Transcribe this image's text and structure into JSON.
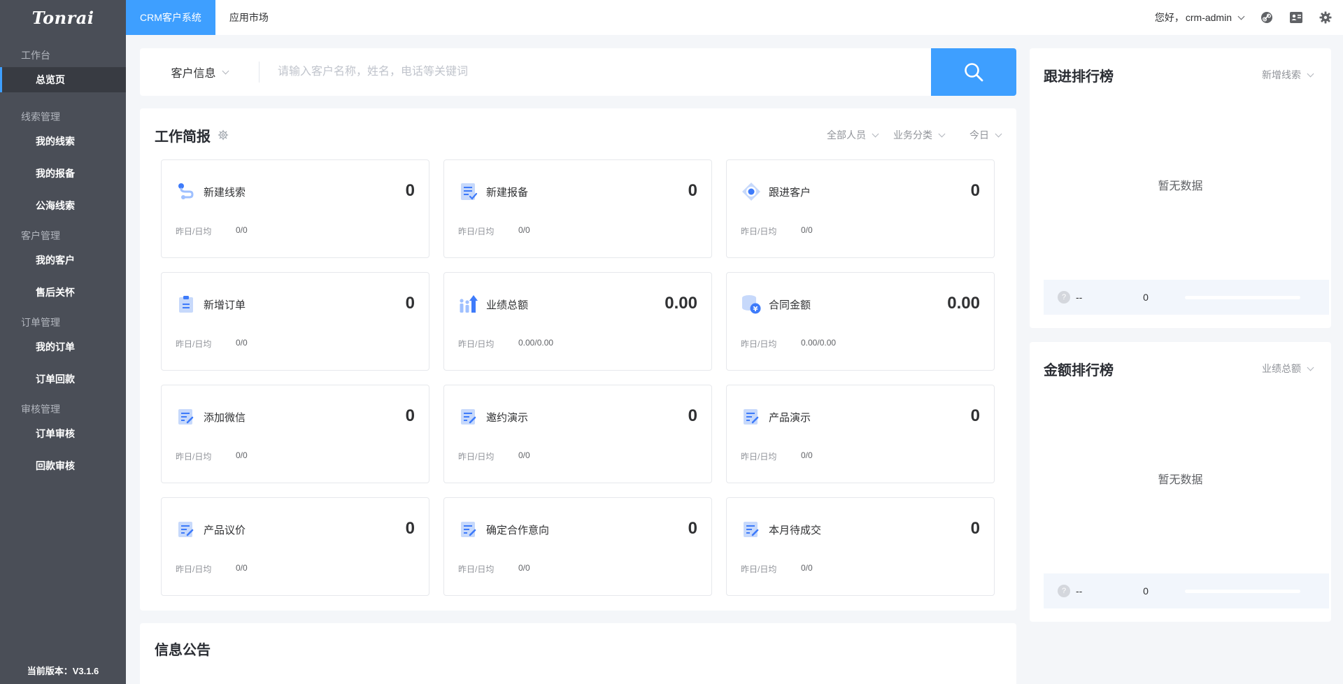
{
  "app": {
    "logo": "Tonrai"
  },
  "sidebar": {
    "groups": [
      {
        "title": "工作台",
        "items": [
          {
            "label": "总览页",
            "active": true
          }
        ]
      },
      {
        "title": "线索管理",
        "items": [
          {
            "label": "我的线索"
          },
          {
            "label": "我的报备"
          },
          {
            "label": "公海线索"
          }
        ]
      },
      {
        "title": "客户管理",
        "items": [
          {
            "label": "我的客户"
          },
          {
            "label": "售后关怀"
          }
        ]
      },
      {
        "title": "订单管理",
        "items": [
          {
            "label": "我的订单"
          },
          {
            "label": "订单回款"
          }
        ]
      },
      {
        "title": "审核管理",
        "items": [
          {
            "label": "订单审核"
          },
          {
            "label": "回款审核"
          }
        ]
      }
    ],
    "version": "当前版本：V3.1.6"
  },
  "topbar": {
    "tabs": [
      {
        "label": "CRM客户系统",
        "active": true
      },
      {
        "label": "应用市场"
      }
    ],
    "greeting": "您好，",
    "user": "crm-admin",
    "icons": [
      "link-icon",
      "contact-card-icon",
      "settings-icon"
    ]
  },
  "search": {
    "category": "客户信息",
    "placeholder": "请输入客户名称，姓名，电话等关键词"
  },
  "brief": {
    "title": "工作简报",
    "filters": {
      "people": "全部人员",
      "business": "业务分类",
      "period": "今日"
    },
    "sub_label": "昨日/日均",
    "stats": [
      {
        "label": "新建线索",
        "value": "0",
        "sub": "0/0",
        "icon": "clue-icon"
      },
      {
        "label": "新建报备",
        "value": "0",
        "sub": "0/0",
        "icon": "report-icon"
      },
      {
        "label": "跟进客户",
        "value": "0",
        "sub": "0/0",
        "icon": "follow-icon"
      },
      {
        "label": "新增订单",
        "value": "0",
        "sub": "0/0",
        "icon": "order-icon"
      },
      {
        "label": "业绩总额",
        "value": "0.00",
        "sub": "0.00/0.00",
        "icon": "performance-icon"
      },
      {
        "label": "合同金额",
        "value": "0.00",
        "sub": "0.00/0.00",
        "icon": "contract-amount-icon"
      },
      {
        "label": "添加微信",
        "value": "0",
        "sub": "0/0",
        "icon": "wechat-note-icon"
      },
      {
        "label": "邀约演示",
        "value": "0",
        "sub": "0/0",
        "icon": "invite-note-icon"
      },
      {
        "label": "产品演示",
        "value": "0",
        "sub": "0/0",
        "icon": "demo-note-icon"
      },
      {
        "label": "产品议价",
        "value": "0",
        "sub": "0/0",
        "icon": "bargain-note-icon"
      },
      {
        "label": "确定合作意向",
        "value": "0",
        "sub": "0/0",
        "icon": "intent-note-icon"
      },
      {
        "label": "本月待成交",
        "value": "0",
        "sub": "0/0",
        "icon": "pending-deal-note-icon"
      }
    ]
  },
  "notice": {
    "title": "信息公告"
  },
  "rankings": [
    {
      "title": "跟进排行榜",
      "filter": "新增线索",
      "empty": "暂无数据",
      "row": {
        "name": "--",
        "value": "0",
        "progress": 0
      }
    },
    {
      "title": "金额排行榜",
      "filter": "业绩总额",
      "empty": "暂无数据",
      "row": {
        "name": "--",
        "value": "0",
        "progress": 0
      }
    }
  ],
  "colors": {
    "accent": "#3e9fff",
    "sidebar": "#4a4e57",
    "sidebar_active": "#383b42"
  }
}
